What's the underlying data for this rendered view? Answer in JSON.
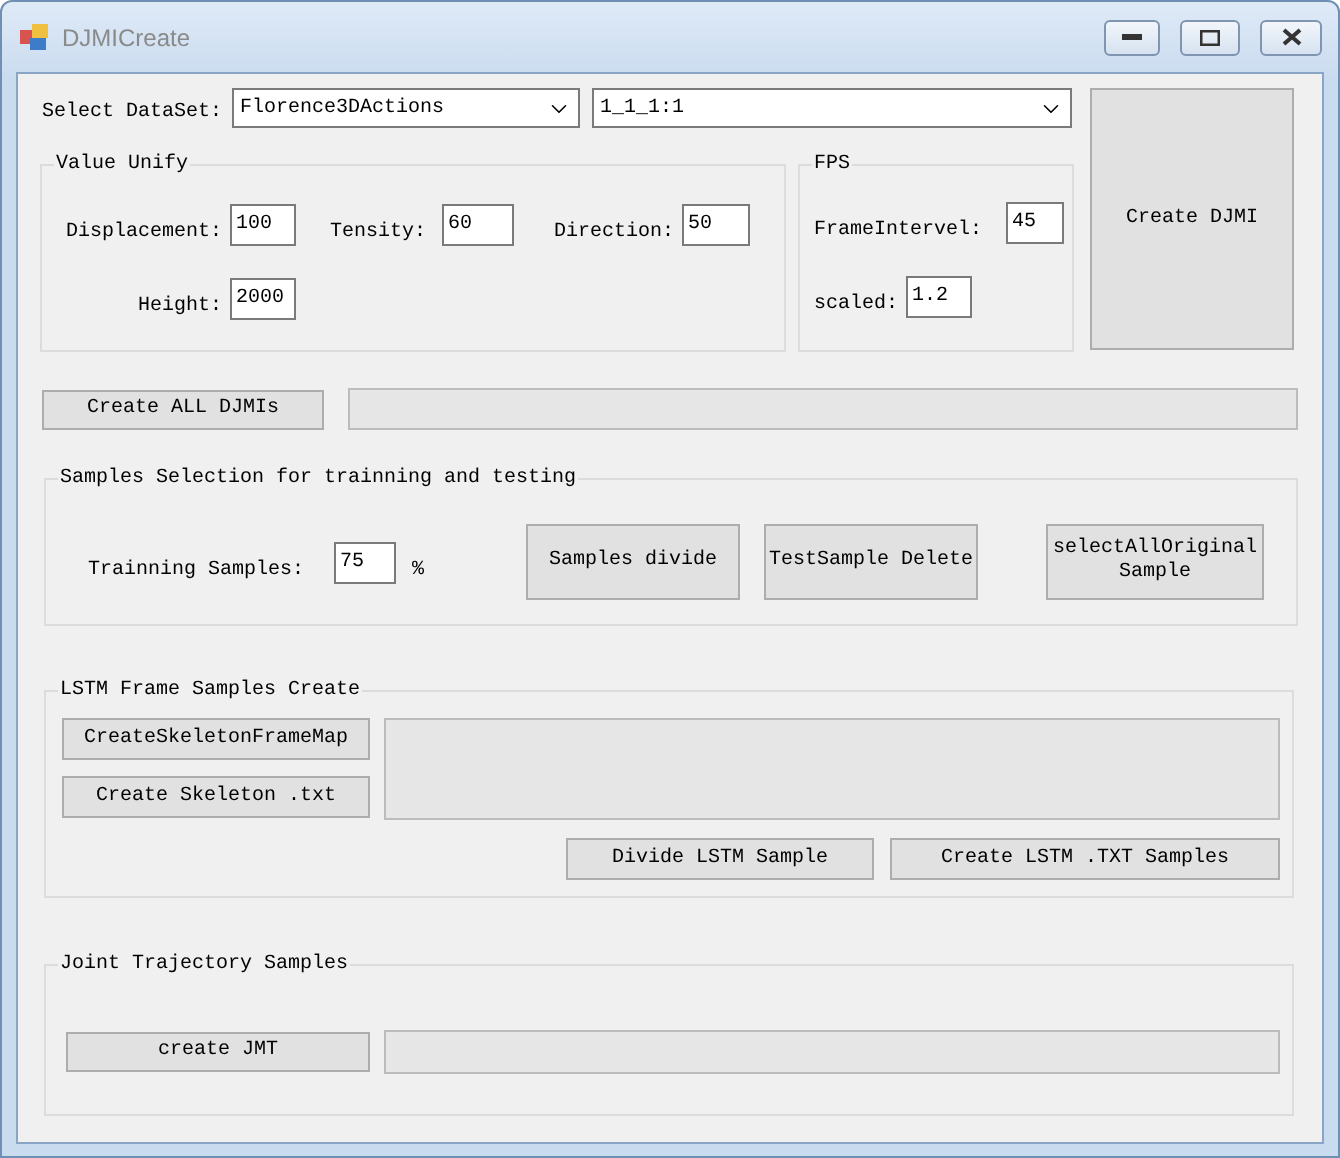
{
  "window": {
    "title": "DJMICreate"
  },
  "dataset": {
    "label": "Select DataSet:",
    "combos": [
      {
        "value": "Florence3DActions"
      },
      {
        "value": "1_1_1:1"
      }
    ]
  },
  "create_djmi": "Create DJMI",
  "value_unify": {
    "title": "Value Unify",
    "fields": [
      {
        "label": "Displacement:",
        "value": "100"
      },
      {
        "label": "Tensity:",
        "value": "60"
      },
      {
        "label": "Direction:",
        "value": "50"
      },
      {
        "label": "Height:",
        "value": "2000"
      }
    ]
  },
  "fps": {
    "title": "FPS",
    "fields": [
      {
        "label": "FrameIntervel:",
        "value": "45"
      },
      {
        "label": "scaled:",
        "value": "1.2"
      }
    ]
  },
  "create_all": "Create ALL DJMIs",
  "create_all_progress": {
    "level": 0
  },
  "samples": {
    "title": "Samples Selection for trainning and testing",
    "label": "Trainning Samples:",
    "value": "75",
    "unit": "%",
    "buttons": [
      "Samples divide",
      "TestSample Delete",
      "selectAllOriginalSample"
    ]
  },
  "lstm": {
    "title": "LSTM Frame Samples Create",
    "side_buttons": [
      "CreateSkeletonFrameMap",
      "Create Skeleton .txt"
    ],
    "bottom_buttons": [
      "Divide LSTM Sample",
      "Create LSTM .TXT Samples"
    ]
  },
  "joint": {
    "title": "Joint Trajectory Samples",
    "button": "create JMT",
    "progress": {
      "level": 0
    }
  }
}
